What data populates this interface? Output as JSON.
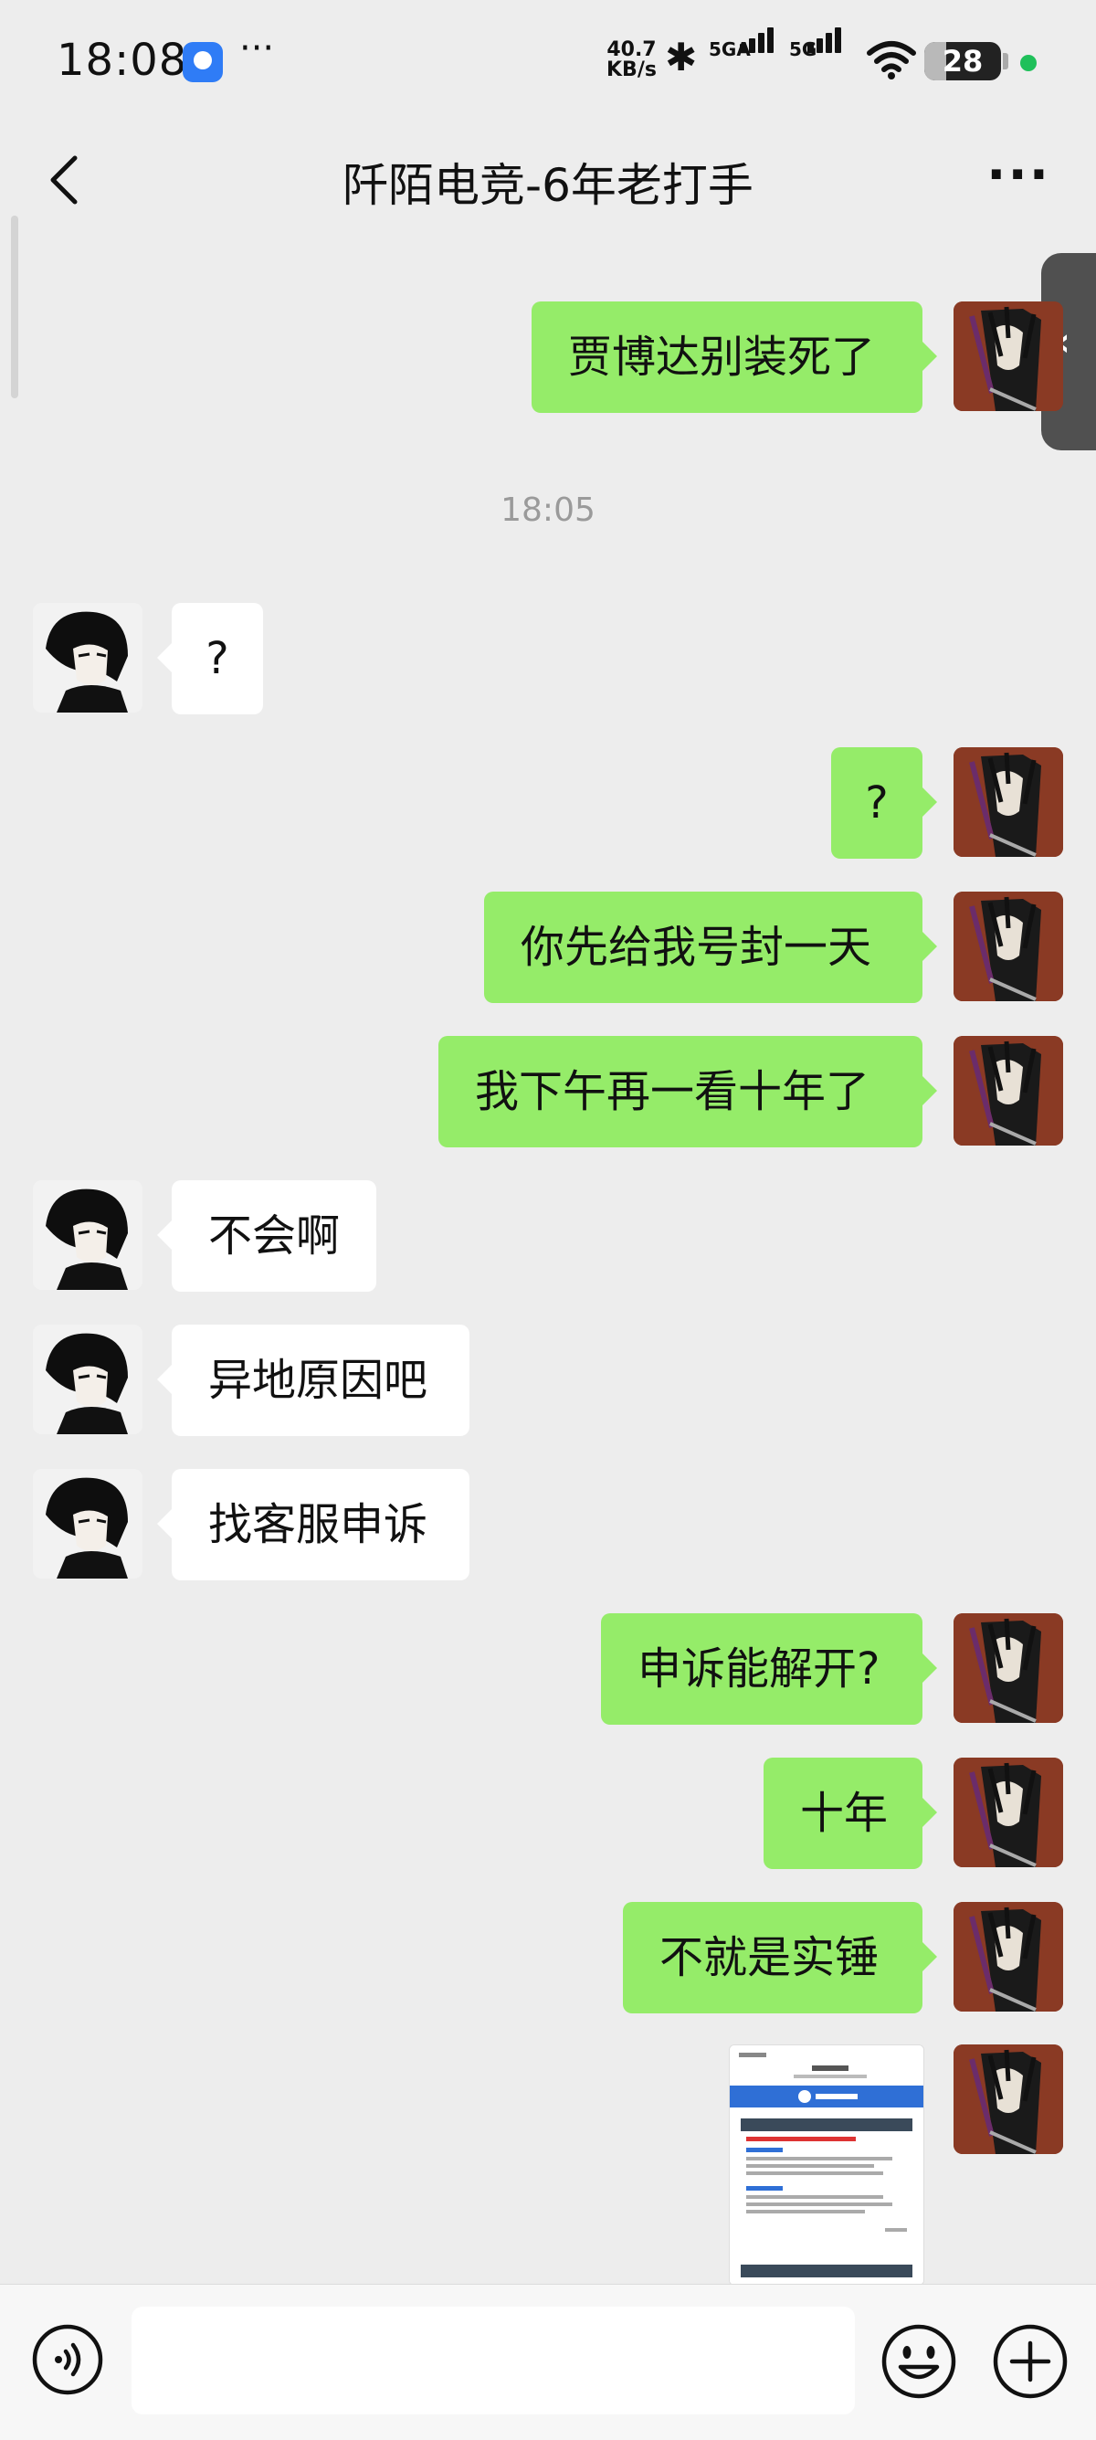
{
  "status_bar": {
    "time": "18:08",
    "net_speed_value": "40.7",
    "net_speed_unit": "KB/s",
    "sim1_label": "5GA",
    "sim2_label": "5G",
    "battery": "28",
    "battery_level": 0.28,
    "dot_color": "#1fc05a"
  },
  "header": {
    "title": "阡陌电竞-6年老打手"
  },
  "chat": {
    "timestamp": "18:05",
    "messages": [
      {
        "from": "self",
        "text": "贾博达别装死了"
      },
      {
        "from": "peer",
        "text": "?"
      },
      {
        "from": "self",
        "text": "?"
      },
      {
        "from": "self",
        "text": "你先给我号封一天"
      },
      {
        "from": "self",
        "text": "我下午再一看十年了"
      },
      {
        "from": "peer",
        "text": "不会啊"
      },
      {
        "from": "peer",
        "text": "异地原因吧"
      },
      {
        "from": "peer",
        "text": "找客服申诉"
      },
      {
        "from": "self",
        "text": "申诉能解开?"
      },
      {
        "from": "self",
        "text": "十年"
      },
      {
        "from": "self",
        "text": "不就是实锤"
      },
      {
        "from": "self",
        "type": "image",
        "text": ""
      }
    ],
    "bubble_colors": {
      "self": "#95ec69",
      "peer": "#ffffff"
    }
  },
  "input_bar": {
    "placeholder": "",
    "icons": [
      "voice-icon",
      "emoji-icon",
      "plus-icon"
    ]
  }
}
